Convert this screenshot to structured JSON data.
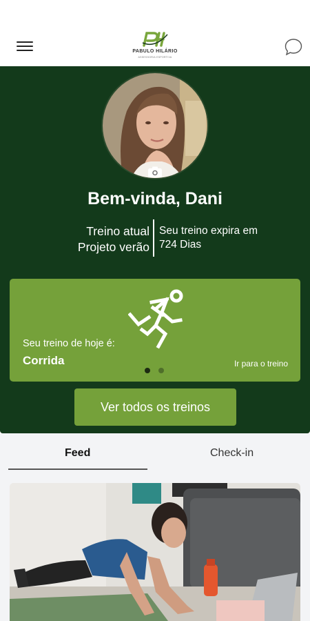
{
  "header": {
    "menu_icon": "hamburger-menu-icon",
    "logo_brand": "PABULO HILÁRIO",
    "logo_tagline": "ASSESSORIA ESPORTIVA",
    "chat_icon": "chat-bubble-icon"
  },
  "profile": {
    "greeting": "Bem-vinda, Dani",
    "camera_icon": "camera-icon",
    "current_label": "Treino atual",
    "current_value": "Projeto verão",
    "expires_label": "Seu treino expira em",
    "expires_value": "724 Dias"
  },
  "today": {
    "question": "Seu treino de hoje é:",
    "workout": "Corrida",
    "goto_label": "Ir para o treino",
    "icon": "running-person-icon",
    "slide_count": 2,
    "active_slide": 1
  },
  "actions": {
    "all_workouts_label": "Ver todos os treinos"
  },
  "tabs": [
    {
      "label": "Feed",
      "active": true
    },
    {
      "label": "Check-in",
      "active": false
    }
  ],
  "colors": {
    "hero_bg": "#133a1b",
    "accent": "#75a13a",
    "tabs_bg": "#f3f4f6"
  }
}
